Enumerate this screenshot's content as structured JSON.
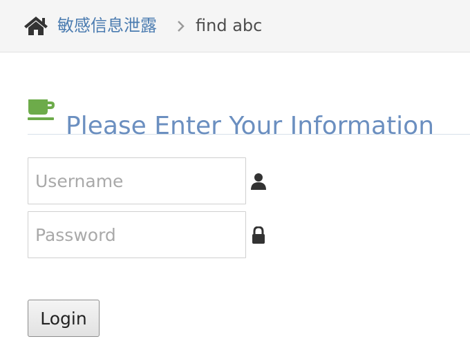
{
  "breadcrumb": {
    "home_icon": "home-icon",
    "link_label": "敏感信息泄露",
    "current_label": "find abc"
  },
  "section": {
    "icon": "coffee-icon",
    "title": "Please Enter Your Information"
  },
  "form": {
    "username": {
      "placeholder": "Username",
      "value": "",
      "icon": "user-icon"
    },
    "password": {
      "placeholder": "Password",
      "value": "",
      "icon": "lock-icon"
    },
    "login_label": "Login"
  },
  "colors": {
    "link": "#4a7bb0",
    "title": "#6b8fc0",
    "coffee": "#6dab4a",
    "icon": "#333333"
  }
}
